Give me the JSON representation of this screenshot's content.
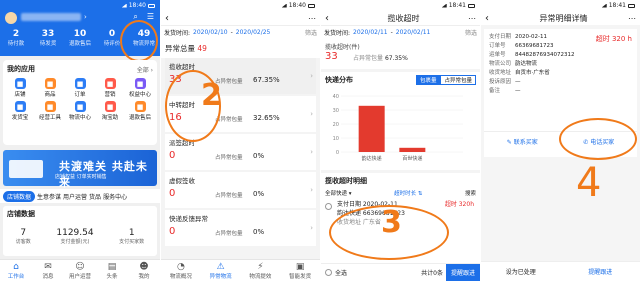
{
  "status": {
    "time": "18:40",
    "time2": "18:41"
  },
  "p1": {
    "stats": [
      {
        "n": "2",
        "l": "待付款"
      },
      {
        "n": "33",
        "l": "待发货"
      },
      {
        "n": "10",
        "l": "退款售后"
      },
      {
        "n": "0",
        "l": "待评价"
      },
      {
        "n": "49",
        "l": "物流异常"
      }
    ],
    "myapp": "我的应用",
    "all": "全部 ›",
    "apps": [
      {
        "l": "店铺",
        "c": "#2d7df5"
      },
      {
        "l": "商品",
        "c": "#ff8a2a"
      },
      {
        "l": "订单",
        "c": "#2d7df5"
      },
      {
        "l": "营销",
        "c": "#ff5a4a"
      },
      {
        "l": "权益中心",
        "c": "#7a5af5"
      },
      {
        "l": "发货宝",
        "c": "#2d7df5"
      },
      {
        "l": "经营工具",
        "c": "#ff8a2a"
      },
      {
        "l": "物流中心",
        "c": "#2d7df5"
      },
      {
        "l": "淘宝助",
        "c": "#ff5a4a"
      },
      {
        "l": "退款售后",
        "c": "#ff8a2a"
      }
    ],
    "banner1": "共渡难关 共赴未来",
    "banner2": "店铺权益 订单实时销售",
    "tabs": [
      "店铺数据",
      "生意参谋",
      "用户运营",
      "货品",
      "服务中心"
    ],
    "shopdata": "店铺数据",
    "sd": [
      {
        "n": "7",
        "l": "访客数"
      },
      {
        "n": "1129.54",
        "l": "支付金额(元)"
      },
      {
        "n": "1",
        "l": "支付买家数"
      }
    ],
    "bnav": [
      "工作台",
      "消息",
      "用户运营",
      "头条",
      "我的"
    ]
  },
  "p2": {
    "datelabel": "发货时间:",
    "d1": "2020/02/10",
    "d2": "2020/02/25",
    "filter": "筛选",
    "total_label": "异常总量",
    "total": "49",
    "cards": [
      {
        "t": "揽收超时",
        "n": "33",
        "pl": "占异常包量",
        "pv": "67.35%"
      },
      {
        "t": "中转超时",
        "n": "16",
        "pl": "占异常包量",
        "pv": "32.65%"
      },
      {
        "t": "派签超时",
        "n": "0",
        "pl": "占异常包量",
        "pv": "0%"
      },
      {
        "t": "虚假签收",
        "n": "0",
        "pl": "占异常包量",
        "pv": "0%"
      },
      {
        "t": "快递反馈异常",
        "n": "0",
        "pl": "占异常包量",
        "pv": "0%"
      }
    ],
    "bnav": [
      "物流概况",
      "异常物流",
      "物流提效",
      "智能发货"
    ]
  },
  "p3": {
    "title": "揽收超时",
    "datelabel": "发货时间:",
    "d1": "2020/02/11",
    "d2": "2020/02/11",
    "filter": "筛选",
    "s1": "揽收超时(件)",
    "n": "33",
    "pl": "占异常包量",
    "pv": "67.35%",
    "dist": "快递分布",
    "b1": "包裹量",
    "b2": "占异常包量",
    "chart_data": {
      "type": "bar",
      "categories": [
        "韵达快递",
        "百世快递"
      ],
      "values": [
        33,
        3
      ],
      "ylim": [
        0,
        40
      ],
      "yticks": [
        "40",
        "30",
        "20",
        "10",
        "0"
      ]
    },
    "detail": "揽收超时明细",
    "f1": "全部快递 ▾",
    "f2": "超时时长 ⇅",
    "f3": "搜索",
    "row": {
      "date": "支付日期  2020-02-11",
      "tag": "超时 320h",
      "tel": "订单号  66369681723",
      "co": "韵达快递  66369681723",
      "addr": "收货地址  广东省"
    },
    "selall": "全选",
    "cnt": "共计0条",
    "btn": "提醒跟进"
  },
  "p4": {
    "title": "异常明细详情",
    "od": "超时 320 h",
    "kv": [
      {
        "k": "支付日期",
        "v": "2020-02-11"
      },
      {
        "k": "订单号",
        "v": "66369681723"
      },
      {
        "k": "运单号",
        "v": "84482876934072312"
      },
      {
        "k": "物流公司",
        "v": "韵达物流"
      },
      {
        "k": "收货地址",
        "v": "自贡市·广东省"
      },
      {
        "k": "投诉原因",
        "v": "—"
      },
      {
        "k": "备注",
        "v": "—"
      }
    ],
    "a1": "联系买家",
    "a2": "电话买家",
    "b1": "设为已处理",
    "b2": "提醒跟进"
  }
}
